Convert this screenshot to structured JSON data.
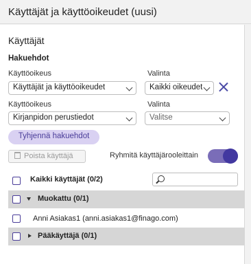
{
  "header": {
    "title": "Käyttäjät ja käyttöoikeudet (uusi)"
  },
  "section": {
    "title": "Käyttäjät",
    "subtitle": "Hakuehdot"
  },
  "filters": [
    {
      "left_label": "Käyttöoikeus",
      "left_value": "Käyttäjät ja käyttöoikeudet",
      "right_label": "Valinta",
      "right_value": "Kaikki oikeudet",
      "has_clear": true
    },
    {
      "left_label": "Käyttöoikeus",
      "left_value": "Kirjanpidon perustiedot",
      "right_label": "Valinta",
      "right_value": "Valitse",
      "right_is_placeholder": true
    }
  ],
  "buttons": {
    "clear_filters": "Tyhjennä hakuehdot",
    "delete_user": "Poista käyttäjä"
  },
  "grouping": {
    "label": "Ryhmitä käyttäjärooleittain",
    "enabled": true
  },
  "list": {
    "all_users_label": "Kaikki käyttäjät (0/2)",
    "search": {
      "placeholder": "",
      "value": ""
    },
    "groups": [
      {
        "label": "Muokattu (0/1)",
        "expanded": true,
        "users": [
          "Anni Asiakas1 (anni.asiakas1@finago.com)"
        ]
      },
      {
        "label": "Pääkäyttäjä (0/1)",
        "expanded": false,
        "users": []
      }
    ]
  },
  "colors": {
    "accent": "#4a3d99",
    "toggle_track": "#7a6db8",
    "toggle_knob": "#4238a0",
    "pill_bg": "#d9d1f2",
    "group_bg": "#d6d6d6"
  }
}
